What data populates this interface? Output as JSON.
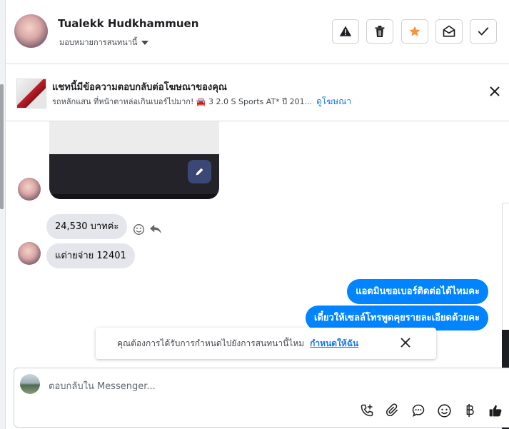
{
  "header": {
    "name": "Tualekk Hudkhammuen",
    "assign_label": "มอบหมายการสนทนานี้",
    "buttons": [
      "report-icon",
      "trash-icon",
      "star-icon",
      "mark-unread-icon",
      "check-icon"
    ],
    "star_color": "#f7923e"
  },
  "ad_banner": {
    "title": "แชทนี้มีข้อความตอบกลับต่อโฆษณาของคุณ",
    "subtitle": "รถหลักแสน ที่หน้าตาหล่อเกินเบอร์ไปมาก! 🚘 3 2.0 S Sports AT* ปี 201...",
    "link": "ดูโฆษณา"
  },
  "messages": {
    "price": "24,530 บาทค่ะ",
    "expense": "แต่ายจ่าย 12401",
    "out1": "แอดมินขอเบอร์ติดต่อได้ไหมคะ",
    "out2": "เดี๋ยวให้เซลล์โทรพูดคุยรายละเอียดด้วยคะ"
  },
  "assign_prompt": {
    "text": "คุณต้องการได้รับการกำหนดไปยังการสนทนานี้ไหม",
    "link": "กำหนดให้ฉัน"
  },
  "composer": {
    "placeholder": "ตอบกลับใน Messenger...",
    "icons": [
      "phone-plus-icon",
      "paperclip-icon",
      "saved-reply-icon",
      "emoji-icon",
      "baht-icon",
      "thumbs-up-icon"
    ]
  },
  "colors": {
    "accent": "#0084ff",
    "link": "#1877f2",
    "incoming_bubble": "#e4e6eb",
    "edit_button": "#3b4875"
  }
}
